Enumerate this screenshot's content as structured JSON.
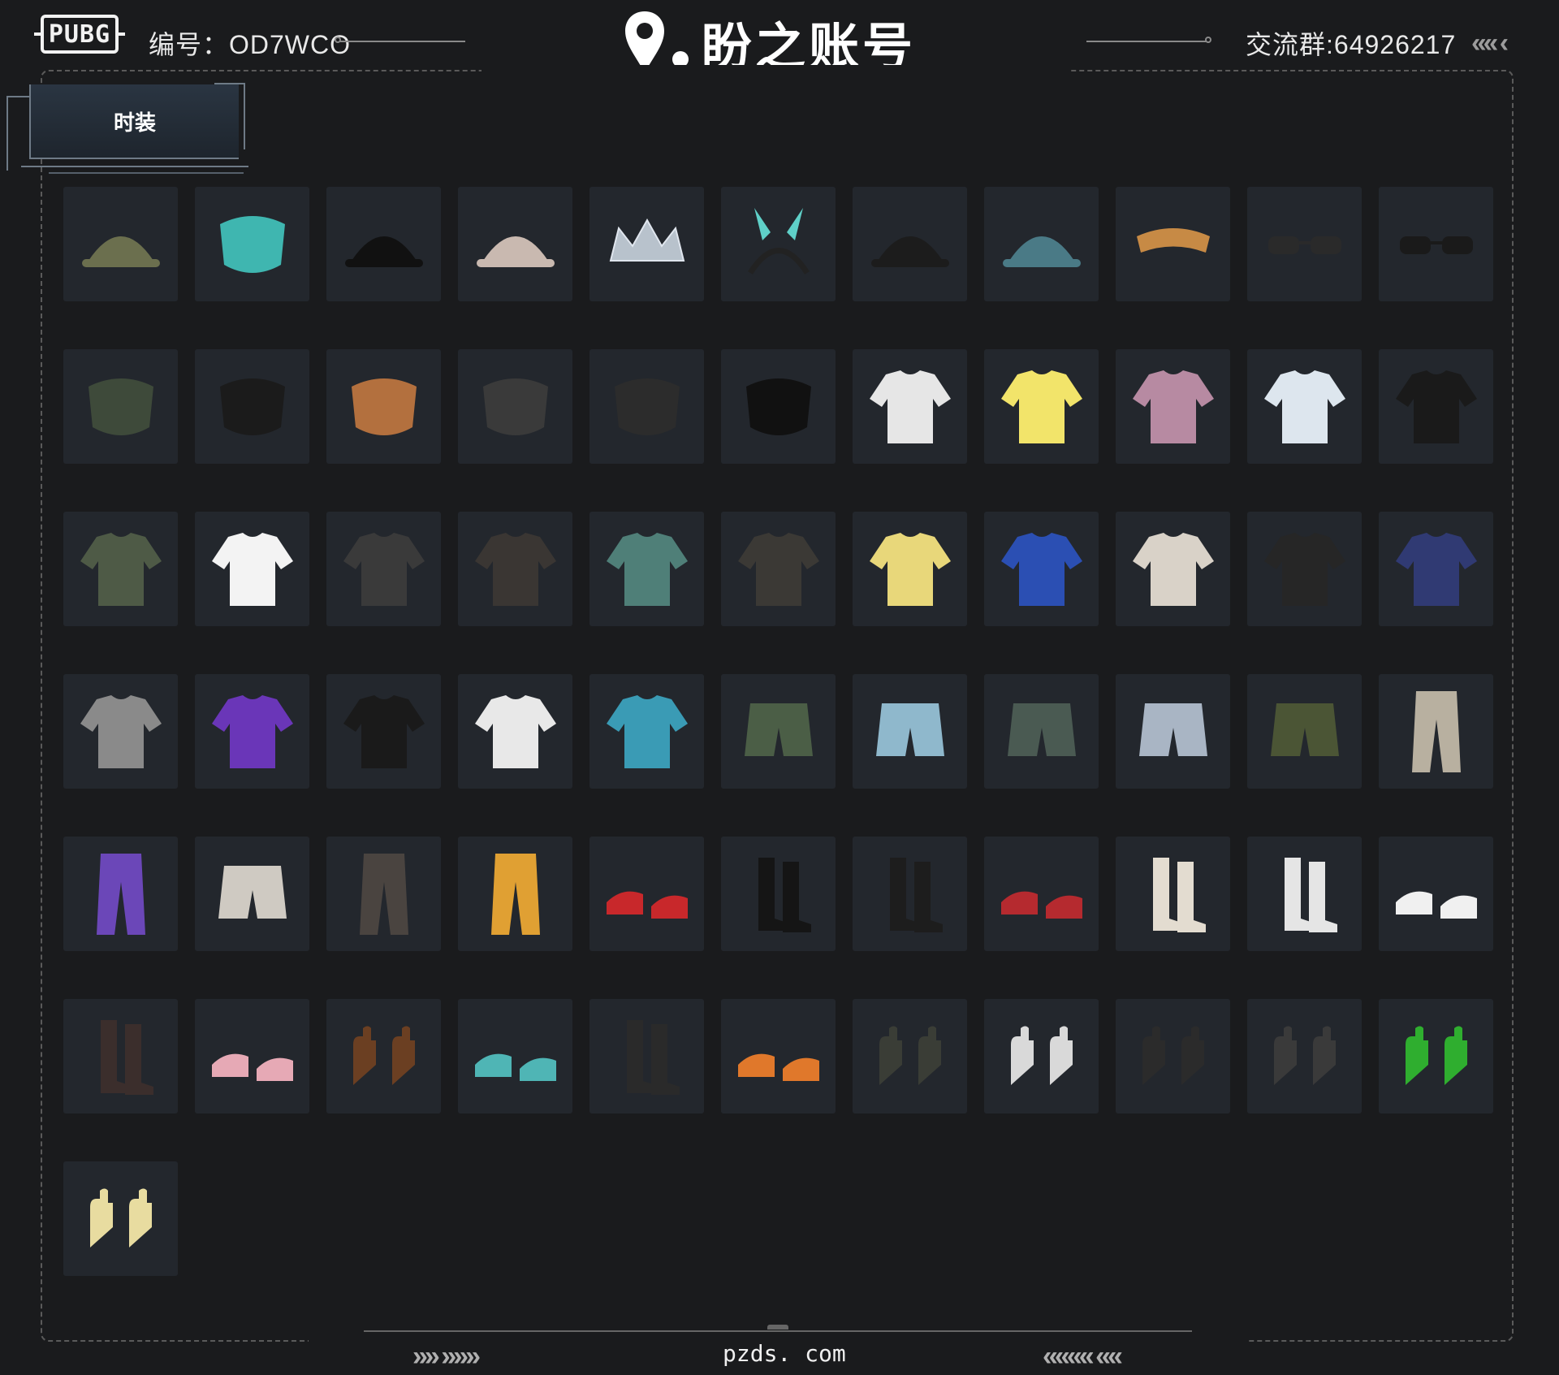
{
  "header": {
    "logo_text": "PUBG",
    "account_id": "编号：OD7WCO",
    "brand_name": "盼之账号",
    "qq_group": "交流群:64926217",
    "chevrons_right": "‹‹‹‹ ‹"
  },
  "tab": {
    "label": "时装"
  },
  "items": [
    {
      "icon": "headset-cap-icon",
      "color": "#6b6f4e"
    },
    {
      "icon": "fox-mask-icon",
      "color": "#3fb6b0"
    },
    {
      "icon": "bucket-hat-icon",
      "color": "#111111"
    },
    {
      "icon": "horned-hat-icon",
      "color": "#c9b9b0"
    },
    {
      "icon": "crown-icon",
      "color": "#b8c2cc"
    },
    {
      "icon": "bunny-headband-icon",
      "color": "#222222"
    },
    {
      "icon": "baseball-cap-icon",
      "color": "#1c1c1c"
    },
    {
      "icon": "fishing-hat-icon",
      "color": "#4a7a86"
    },
    {
      "icon": "visor-icon",
      "color": "#c78a45"
    },
    {
      "icon": "sunglasses-icon",
      "color": "#2a2a2a"
    },
    {
      "icon": "sunglasses-dark-icon",
      "color": "#1a1a1a"
    },
    {
      "icon": "face-scarf-icon",
      "color": "#3e4a3a"
    },
    {
      "icon": "tech-mask-icon",
      "color": "#1b1b1b"
    },
    {
      "icon": "chimp-mask-icon",
      "color": "#b3703e"
    },
    {
      "icon": "hood-scarf-icon",
      "color": "#3a3a3a"
    },
    {
      "icon": "gas-mask-icon",
      "color": "#2c2c2c"
    },
    {
      "icon": "shark-face-mask-icon",
      "color": "#111111"
    },
    {
      "icon": "tank-top-icon",
      "color": "#e6e6e6"
    },
    {
      "icon": "tshirt-yellow-icon",
      "color": "#f2e46a"
    },
    {
      "icon": "crop-top-pink-icon",
      "color": "#b78aa2"
    },
    {
      "icon": "frill-dress-top-icon",
      "color": "#dde6ee"
    },
    {
      "icon": "black-jacket-icon",
      "color": "#1a1a1a"
    },
    {
      "icon": "camo-jacket-icon",
      "color": "#4e5a46"
    },
    {
      "icon": "white-crop-tee-icon",
      "color": "#f3f3f3"
    },
    {
      "icon": "graffiti-jacket-icon",
      "color": "#3a3a3a"
    },
    {
      "icon": "graphic-vest-icon",
      "color": "#3a3633"
    },
    {
      "icon": "floral-shirt-icon",
      "color": "#4f7f78"
    },
    {
      "icon": "leather-jacket-icon",
      "color": "#3b3935"
    },
    {
      "icon": "yellow-sweater-icon",
      "color": "#e8d77a"
    },
    {
      "icon": "blue-tracksuit-icon",
      "color": "#2b4fb3"
    },
    {
      "icon": "striped-coat-icon",
      "color": "#d9d2c8"
    },
    {
      "icon": "racing-jacket-icon",
      "color": "#262626"
    },
    {
      "icon": "navy-sweatshirt-icon",
      "color": "#303a73"
    },
    {
      "icon": "grey-orange-jacket-icon",
      "color": "#8a8a8a"
    },
    {
      "icon": "purple-jacket-icon",
      "color": "#6a36b8"
    },
    {
      "icon": "black-hoodie-icon",
      "color": "#1a1a1a"
    },
    {
      "icon": "white-orange-parka-icon",
      "color": "#e8e8e8"
    },
    {
      "icon": "gradient-hoodie-icon",
      "color": "#3a9bb5"
    },
    {
      "icon": "green-skirt-icon",
      "color": "#4b5e46"
    },
    {
      "icon": "denim-shorts-icon",
      "color": "#8fb8cc"
    },
    {
      "icon": "cargo-shorts-icon",
      "color": "#4a5a52"
    },
    {
      "icon": "sequin-shorts-icon",
      "color": "#a9b5c4"
    },
    {
      "icon": "green-shorts-icon",
      "color": "#4b5535"
    },
    {
      "icon": "cargo-pants-icon",
      "color": "#b8b0a0"
    },
    {
      "icon": "purple-leggings-icon",
      "color": "#6b47b8"
    },
    {
      "icon": "white-shorts-icon",
      "color": "#cfcac2"
    },
    {
      "icon": "camo-pants-icon",
      "color": "#4a4440"
    },
    {
      "icon": "orange-pants-icon",
      "color": "#e0a033"
    },
    {
      "icon": "red-slides-icon",
      "color": "#c8282b"
    },
    {
      "icon": "black-boots-icon",
      "color": "#151515"
    },
    {
      "icon": "thigh-boots-icon",
      "color": "#1d1d1d"
    },
    {
      "icon": "red-sneakers-icon",
      "color": "#b52a2f"
    },
    {
      "icon": "knit-boots-icon",
      "color": "#e3dcd0"
    },
    {
      "icon": "white-boots-icon",
      "color": "#e5e5e5"
    },
    {
      "icon": "white-sneakers-icon",
      "color": "#f0f0f0"
    },
    {
      "icon": "fishnet-tights-icon",
      "color": "#3b2e2c"
    },
    {
      "icon": "shark-slippers-icon",
      "color": "#e6a9b5"
    },
    {
      "icon": "bear-paws-icon",
      "color": "#6b3f22"
    },
    {
      "icon": "teal-clogs-icon",
      "color": "#4fb5b5"
    },
    {
      "icon": "fur-boots-icon",
      "color": "#2a2a2a"
    },
    {
      "icon": "orange-sneakers-icon",
      "color": "#e0782b"
    },
    {
      "icon": "tactical-gloves-icon",
      "color": "#3a3d36"
    },
    {
      "icon": "claw-nails-icon",
      "color": "#d9d9d9"
    },
    {
      "icon": "spiked-gloves-icon",
      "color": "#2b2b2b"
    },
    {
      "icon": "fingerless-gloves-icon",
      "color": "#3a3a3a"
    },
    {
      "icon": "green-gloves-icon",
      "color": "#2fae2f"
    },
    {
      "icon": "yellow-gloves-icon",
      "color": "#e8dca0"
    }
  ],
  "footer": {
    "chevrons_left": "»» »»»",
    "site": "pzds. com",
    "chevrons_right": "«««« ««"
  }
}
